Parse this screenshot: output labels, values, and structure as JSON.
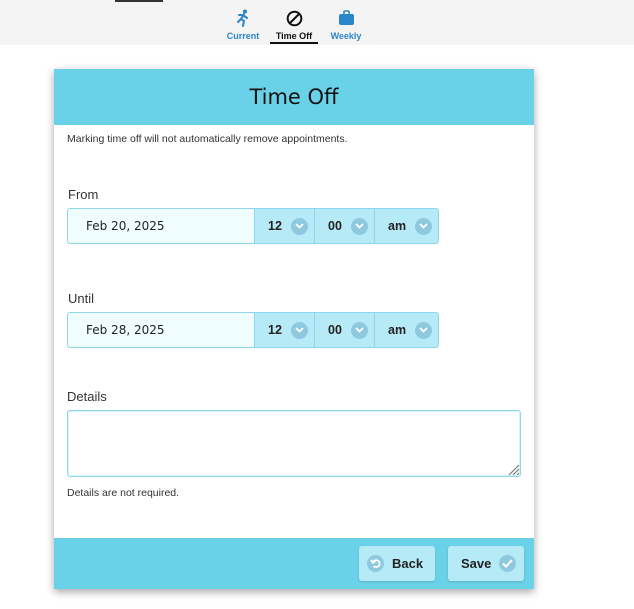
{
  "nav": {
    "tabs": [
      {
        "label": "Current",
        "icon": "running-person-icon"
      },
      {
        "label": "Time Off",
        "icon": "prohibited-icon",
        "active": true
      },
      {
        "label": "Weekly",
        "icon": "briefcase-icon"
      }
    ]
  },
  "card": {
    "title": "Time Off",
    "notice": "Marking time off will not automatically remove appointments.",
    "from": {
      "label": "From",
      "date": "Feb 20, 2025",
      "hour": "12",
      "minute": "00",
      "ampm": "am"
    },
    "until": {
      "label": "Until",
      "date": "Feb 28, 2025",
      "hour": "12",
      "minute": "00",
      "ampm": "am"
    },
    "details": {
      "label": "Details",
      "value": "",
      "hint": "Details are not required."
    },
    "buttons": {
      "back": "Back",
      "save": "Save"
    }
  },
  "colors": {
    "accent": "#6ad2e8",
    "control": "#b7eaf7",
    "link": "#2b86c9"
  }
}
